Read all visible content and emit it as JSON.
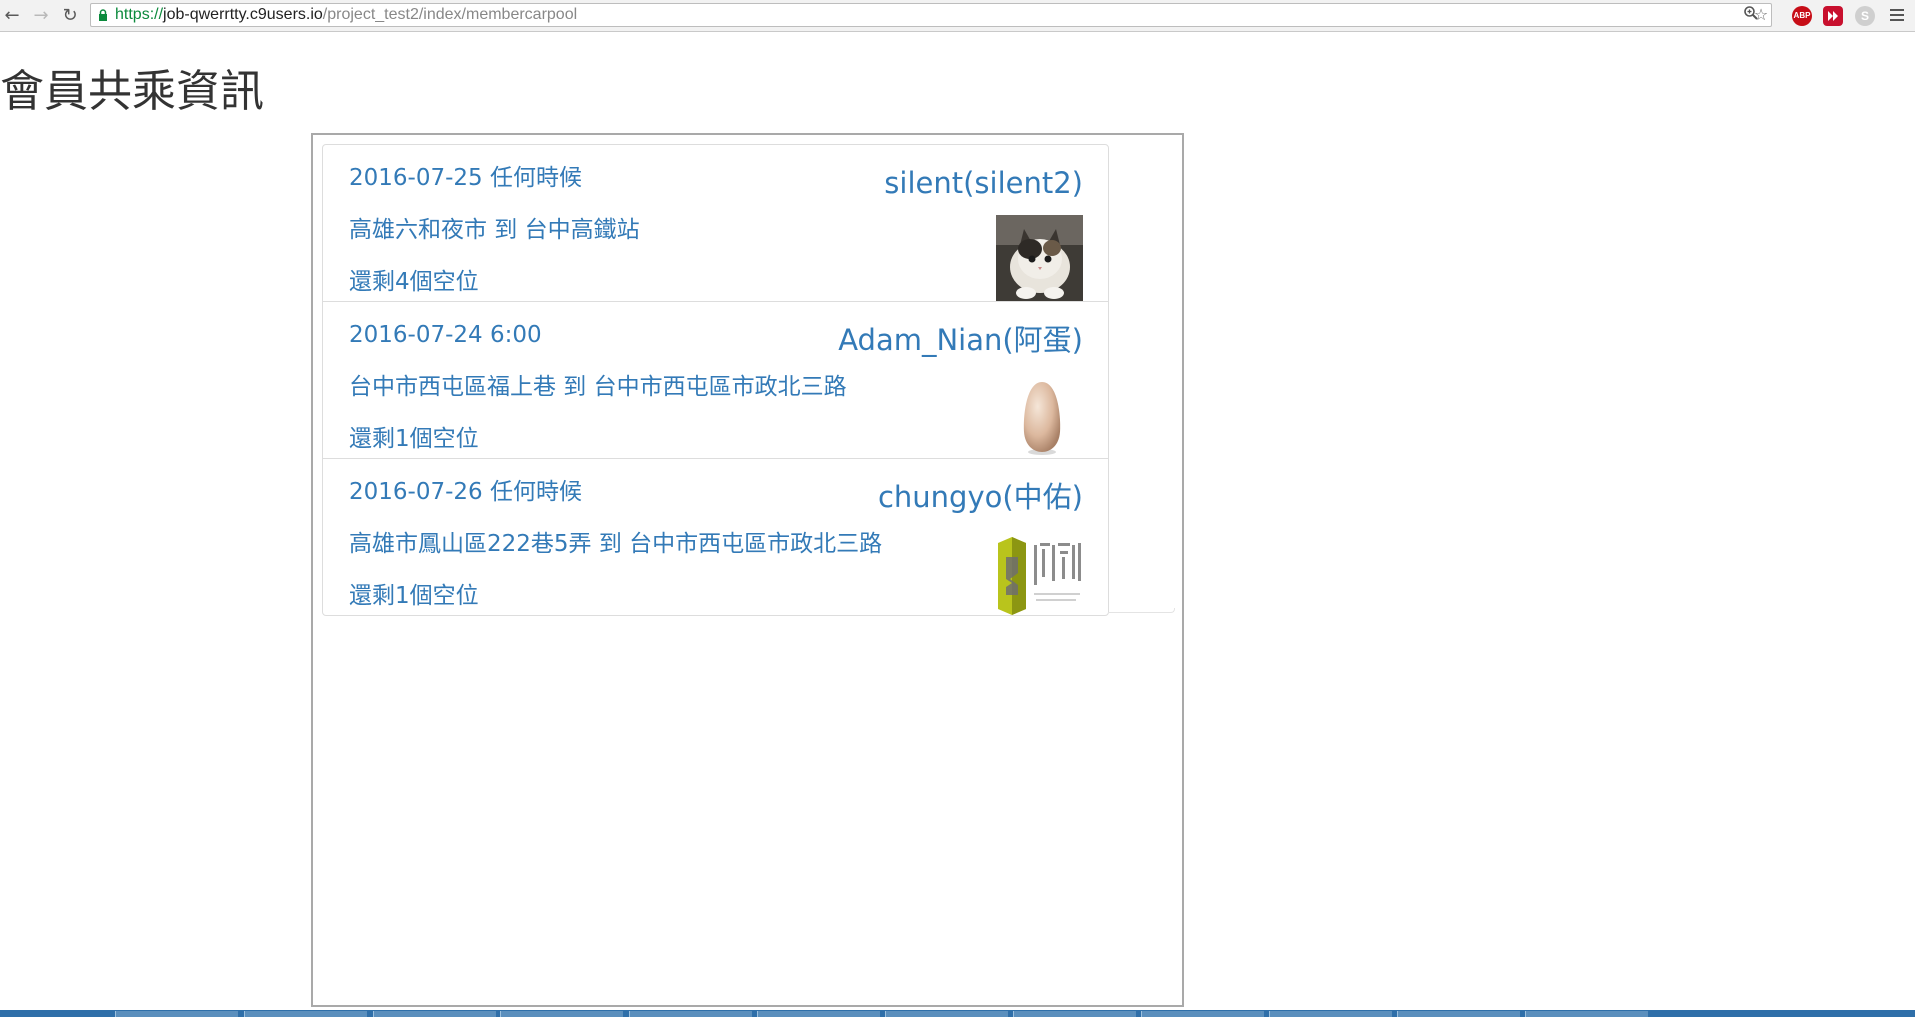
{
  "browser": {
    "url_scheme": "https://",
    "url_host": "job-qwerrtty.c9users.io",
    "url_path": "/project_test2/index/membercarpool",
    "extensions": [
      "ABP"
    ]
  },
  "page": {
    "title": "會員共乘資訊"
  },
  "carpools": [
    {
      "datetime": "2016-07-25 任何時候",
      "route": "高雄六和夜市 到 台中高鐵站",
      "seats": "還剩4個空位",
      "user": "silent(silent2)",
      "avatar": "kitten-avatar"
    },
    {
      "datetime": "2016-07-24 6:00",
      "route": "台中市西屯區福上巷 到 台中市西屯區市政北三路",
      "seats": "還剩1個空位",
      "user": "Adam_Nian(阿蛋)",
      "avatar": "egg-avatar"
    },
    {
      "datetime": "2016-07-26 任何時候",
      "route": "高雄市鳳山區222巷5弄 到 台中市西屯區市政北三路",
      "seats": "還剩1個空位",
      "user": "chungyo(中佑)",
      "avatar": "logo-avatar"
    }
  ],
  "colors": {
    "link": "#337ab7",
    "title": "#333333",
    "border": "#dddddd"
  }
}
